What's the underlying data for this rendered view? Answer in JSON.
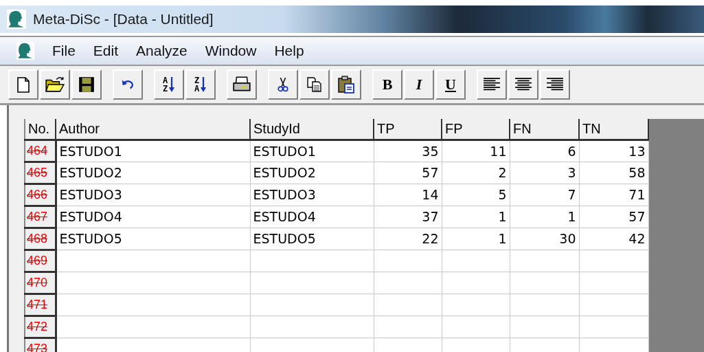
{
  "window": {
    "title": "Meta-DiSc - [Data - Untitled]"
  },
  "menu": [
    {
      "label": "File"
    },
    {
      "label": "Edit"
    },
    {
      "label": "Analyze"
    },
    {
      "label": "Window"
    },
    {
      "label": "Help"
    }
  ],
  "toolbar": [
    [
      {
        "kind": "new"
      },
      {
        "kind": "open"
      },
      {
        "kind": "save"
      }
    ],
    [
      {
        "kind": "undo"
      }
    ],
    [
      {
        "kind": "sort",
        "letters": [
          "A",
          "Z"
        ]
      },
      {
        "kind": "sort",
        "letters": [
          "Z",
          "A"
        ]
      }
    ],
    [
      {
        "kind": "print"
      }
    ],
    [
      {
        "kind": "cut"
      },
      {
        "kind": "copy"
      },
      {
        "kind": "paste"
      }
    ],
    [
      {
        "kind": "bold",
        "label": "B"
      },
      {
        "kind": "italic",
        "label": "I"
      },
      {
        "kind": "underline",
        "label": "U"
      }
    ],
    [
      {
        "kind": "align-left"
      },
      {
        "kind": "align-center"
      },
      {
        "kind": "align-right"
      }
    ]
  ],
  "table": {
    "columns": [
      "No.",
      "Author",
      "StudyId",
      "TP",
      "FP",
      "FN",
      "TN"
    ],
    "rows": [
      {
        "no": "464",
        "cells": [
          "ESTUDO1",
          "ESTUDO1",
          "35",
          "11",
          "6",
          "13"
        ]
      },
      {
        "no": "465",
        "cells": [
          "ESTUDO2",
          "ESTUDO2",
          "57",
          "2",
          "3",
          "58"
        ]
      },
      {
        "no": "466",
        "cells": [
          "ESTUDO3",
          "ESTUDO3",
          "14",
          "5",
          "7",
          "71"
        ]
      },
      {
        "no": "467",
        "cells": [
          "ESTUDO4",
          "ESTUDO4",
          "37",
          "1",
          "1",
          "57"
        ]
      },
      {
        "no": "468",
        "cells": [
          "ESTUDO5",
          "ESTUDO5",
          "22",
          "1",
          "30",
          "42"
        ]
      },
      {
        "no": "469"
      },
      {
        "no": "470"
      },
      {
        "no": "471"
      },
      {
        "no": "472"
      },
      {
        "no": "473"
      }
    ]
  }
}
